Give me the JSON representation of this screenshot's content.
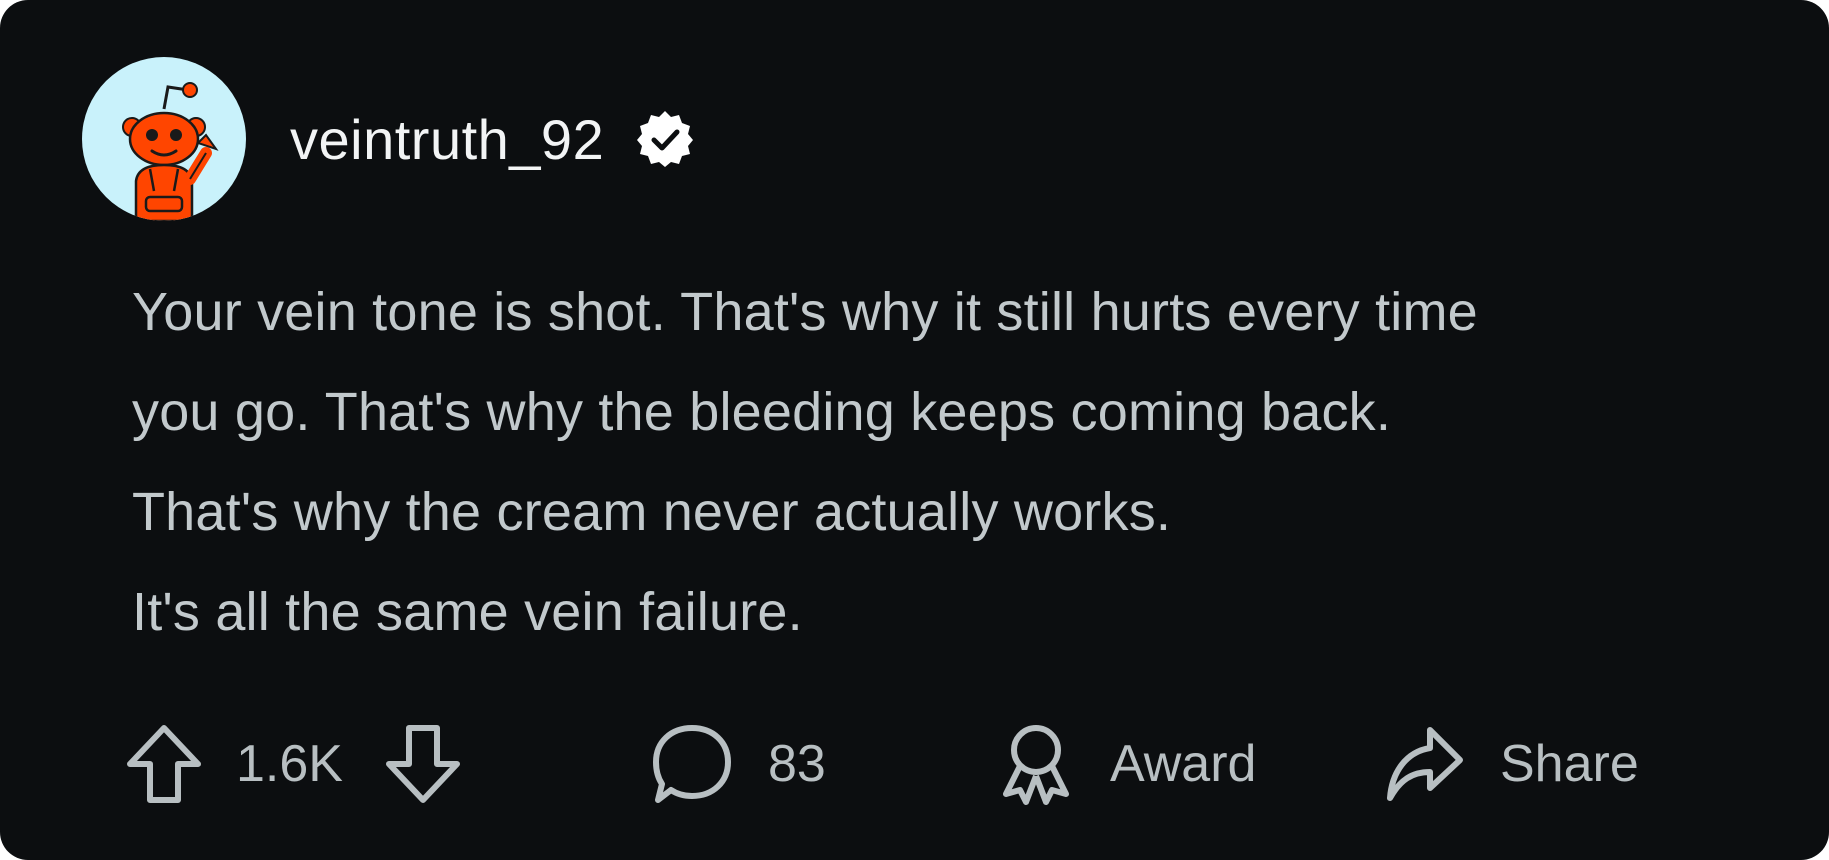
{
  "post": {
    "username": "veintruth_92",
    "verified": true,
    "avatar_icon": "reddit-snoo-avatar-icon",
    "lines": [
      "Your vein tone is shot. That's why it still hurts every time",
      "you go. That's why the bleeding keeps coming back.",
      "That's why the cream never actually works.",
      "It's all the same vein failure."
    ]
  },
  "actions": {
    "upvote_icon": "upvote-arrow-icon",
    "score": "1.6K",
    "downvote_icon": "downvote-arrow-icon",
    "comment_icon": "comment-bubble-icon",
    "comments": "83",
    "award_icon": "award-ribbon-icon",
    "award_label": "Award",
    "share_icon": "share-arrow-icon",
    "share_label": "Share"
  },
  "colors": {
    "background": "#0c0e10",
    "username": "#f2f4f5",
    "body_text": "#c2c9cc",
    "action_text": "#b8bfc2",
    "avatar_bg": "#c9f2fb",
    "snoo_orange": "#ff4500"
  }
}
